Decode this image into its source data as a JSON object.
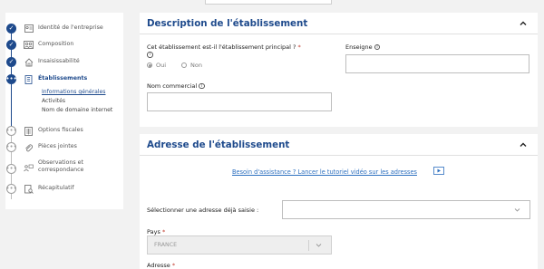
{
  "sidebar": {
    "steps": [
      {
        "label": "Identité de l'entreprise",
        "state": "done",
        "icon": "id-card-icon"
      },
      {
        "label": "Composition",
        "state": "done",
        "icon": "people-icon"
      },
      {
        "label": "Insaisissabilité",
        "state": "done",
        "icon": "house-icon"
      },
      {
        "label": "Établissements",
        "state": "current",
        "icon": "building-icon"
      },
      {
        "label": "Options fiscales",
        "state": "todo",
        "icon": "calculator-icon"
      },
      {
        "label": "Pièces jointes",
        "state": "todo",
        "icon": "paperclip-icon"
      },
      {
        "label": "Observations et correspondance",
        "state": "todo",
        "icon": "chat-icon"
      },
      {
        "label": "Récapitulatif",
        "state": "todo",
        "icon": "document-search-icon"
      }
    ],
    "substeps": [
      {
        "label": "Informations générales",
        "active": true
      },
      {
        "label": "Activités",
        "active": false
      },
      {
        "label": "Nom de domaine internet",
        "active": false
      }
    ]
  },
  "description": {
    "title": "Description de l'établissement",
    "principal_question": "Cet établissement est-il l'établissement principal ?",
    "required_mark": "*",
    "info_glyph": "i",
    "options": [
      "Oui",
      "Non"
    ],
    "selected_option": "Oui",
    "enseigne_label": "Enseigne",
    "enseigne_value": "",
    "nom_commercial_label": "Nom commercial",
    "nom_commercial_value": ""
  },
  "adresse": {
    "title": "Adresse de l'établissement",
    "assistance_link": "Besoin d'assistance ? Lancer le tutoriel vidéo sur les adresses",
    "select_saved_label": "Sélectionner une adresse déjà saisie :",
    "select_saved_value": "",
    "pays_label": "Pays",
    "pays_value": "FRANCE",
    "adresse_label": "Adresse",
    "required_mark": "*"
  },
  "colors": {
    "brand": "#1e4a8c",
    "link": "#2c6fbf",
    "required": "#c0392b",
    "background": "#f2f2f2"
  }
}
